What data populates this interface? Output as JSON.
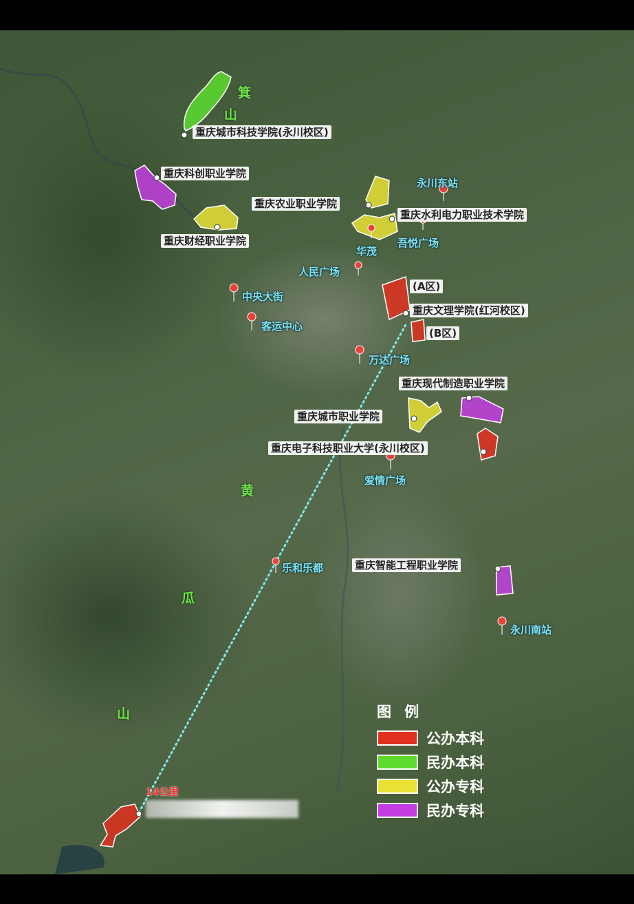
{
  "mountains": {
    "ji_1": "箕",
    "ji_2": "山",
    "huang": "黄",
    "gua": "瓜",
    "shan": "山"
  },
  "campuses": {
    "chengshi_keji": "重庆城市科技学院(永川校区)",
    "kechuang": "重庆科创职业学院",
    "caijing": "重庆财经职业学院",
    "nongye": "重庆农业职业学院",
    "shuili": "重庆水利电力职业技术学院",
    "wenli_a": "(A区)",
    "wenli": "重庆文理学院(红河校区)",
    "wenli_b": "(B区)",
    "xiandai_zhizao": "重庆现代制造职业学院",
    "chengshi_zhiye": "重庆城市职业学院",
    "dianzi_keji": "重庆电子科技职业大学(永川校区)",
    "zhineng": "重庆智能工程职业学院"
  },
  "pois": {
    "yongchuan_east": "永川东站",
    "huamao": "华茂",
    "wuyue": "吾悦广场",
    "renmin": "人民广场",
    "zhongyang": "中央大街",
    "keyun": "客运中心",
    "wanda": "万达广场",
    "aiqing": "爱情广场",
    "lehe": "乐和乐都",
    "yongchuan_south": "永川南站"
  },
  "distance_label": "14公里",
  "legend": {
    "title": "图 例",
    "items": [
      {
        "label": "公办本科",
        "color": "#e0301e"
      },
      {
        "label": "民办本科",
        "color": "#5ddc2f"
      },
      {
        "label": "公办专科",
        "color": "#e8e235"
      },
      {
        "label": "民办专科",
        "color": "#c33ee0"
      }
    ]
  },
  "colors": {
    "public_undergrad": "#e0301e",
    "private_undergrad": "#5ddc2f",
    "public_college": "#e8e235",
    "private_college": "#c33ee0",
    "poi_text": "#7fe0ee",
    "poi_pin": "#e8443a",
    "distance_line": "#7fe8f0"
  }
}
